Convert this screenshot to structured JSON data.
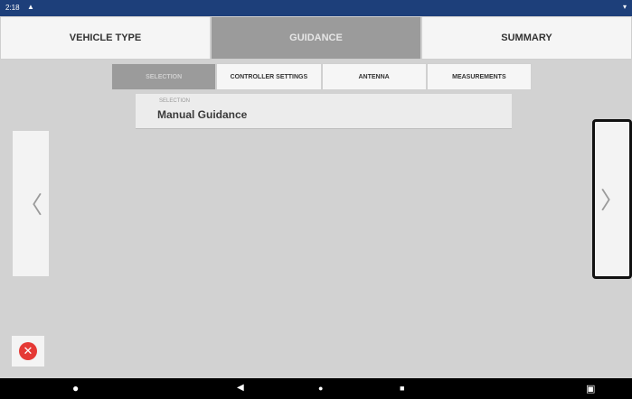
{
  "status_bar": {
    "time": "2:18",
    "left_icon": "warning-icon",
    "right_icon": "signal-icon"
  },
  "tabs": [
    {
      "label": "VEHICLE TYPE"
    },
    {
      "label": "GUIDANCE"
    },
    {
      "label": "SUMMARY"
    }
  ],
  "subtabs": [
    {
      "label": "SELECTION"
    },
    {
      "label": "CONTROLLER SETTINGS"
    },
    {
      "label": "ANTENNA"
    },
    {
      "label": "MEASUREMENTS"
    }
  ],
  "selection": {
    "caption": "SELECTION",
    "value": "Manual Guidance"
  },
  "navigation": {
    "prev_icon": "chevron-left-icon",
    "next_icon": "chevron-right-icon"
  },
  "cancel": {
    "icon": "close-icon",
    "color": "#e53935"
  },
  "android_nav": {
    "app_icon": "logo-icon",
    "back_icon": "back-icon",
    "home_icon": "home-icon",
    "recent_icon": "recent-apps-icon",
    "camera_icon": "camera-icon"
  },
  "colors": {
    "status_bar": "#1d3f7a",
    "active_tab": "#9b9b9b",
    "background": "#d2d2d2"
  }
}
